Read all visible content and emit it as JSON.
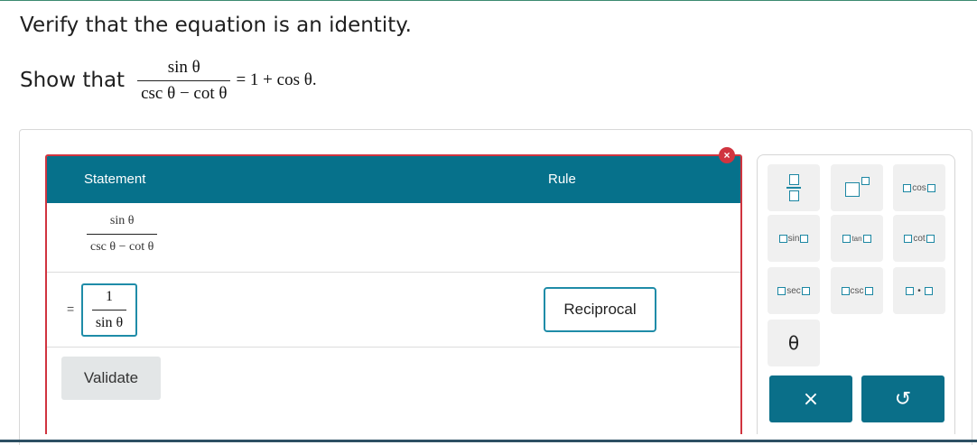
{
  "instruction": "Verify that the equation is an identity.",
  "show": {
    "label": "Show that",
    "numerator": "sin θ",
    "denominator": "csc θ − cot θ",
    "rhs": "= 1 + cos θ."
  },
  "table": {
    "header_statement": "Statement",
    "header_rule": "Rule",
    "row1": {
      "numerator": "sin θ",
      "denominator": "csc θ  −  cot θ"
    },
    "row2": {
      "equals": "=",
      "numerator": "1",
      "denominator": "sin θ",
      "rule": "Reciprocal"
    },
    "validate_label": "Validate",
    "error_badge": "×"
  },
  "keypad": {
    "fn_cos": "cos",
    "fn_sin": "sin",
    "fn_tan": "tan",
    "fn_cot": "cot",
    "fn_sec": "sec",
    "fn_csc": "csc",
    "theta": "θ",
    "dot": "•",
    "clear_glyph": "×",
    "undo_glyph": "↺"
  },
  "colors": {
    "header_bg": "#06718b",
    "accent": "#1c87a3",
    "error": "#d0343f",
    "action_bg": "#0a6f89"
  }
}
